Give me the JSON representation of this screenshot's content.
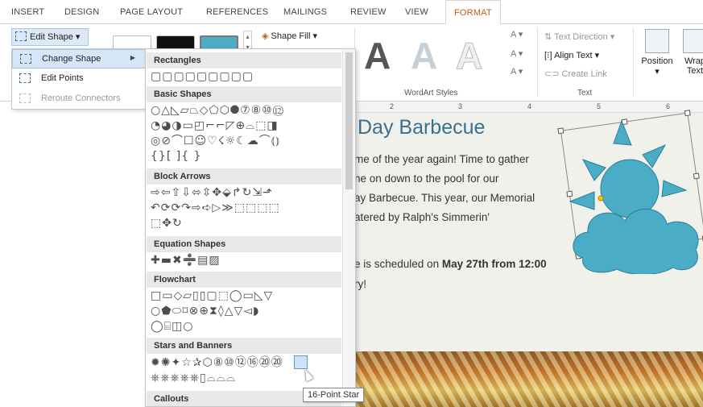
{
  "tabs": {
    "insert": "INSERT",
    "design": "DESIGN",
    "page_layout": "PAGE LAYOUT",
    "references": "REFERENCES",
    "mailings": "MAILINGS",
    "review": "REVIEW",
    "view": "VIEW",
    "format": "FORMAT",
    "active": "FORMAT"
  },
  "ribbon": {
    "edit_shape": "Edit Shape",
    "shape_fill": "Shape Fill",
    "wordart_letter": "A",
    "wordart_styles_label": "WordArt Styles",
    "text_direction": "Text Direction",
    "align_text": "Align Text",
    "create_link": "Create Link",
    "text_group_label": "Text",
    "position_label": "Position",
    "wrap_text_label": "Wrap Text"
  },
  "edit_menu": {
    "items": [
      {
        "label": "Change Shape",
        "has_submenu": true
      },
      {
        "label": "Edit Points",
        "has_submenu": false
      },
      {
        "label": "Reroute Connectors",
        "has_submenu": false,
        "disabled": true
      }
    ]
  },
  "gallery": {
    "sections": [
      {
        "title": "Rectangles",
        "rows": [
          "▢▢▢▢▢▢▢▢▢"
        ]
      },
      {
        "title": "Basic Shapes",
        "rows": [
          "○△◺▱⏢◇⬠⬡⯃⑦⑧⑩⑫",
          "◔◕◑▭◰⌐⌐◸⊕⌓⬚◨",
          "◎⊘⌒☐☺♡☇☼☾☁⌒⦅⦆",
          "{}[ ]{ }"
        ]
      },
      {
        "title": "Block Arrows",
        "rows": [
          "⇨⇦⇧⇩⬄⇳✥⬙↱↻⇲⬏",
          "↶⟳⟳↷⇨➪▷≫⬚⬚⬚⬚",
          "⬚✥↻"
        ]
      },
      {
        "title": "Equation Shapes",
        "rows": [
          "✚▬✖➗▤▨"
        ]
      },
      {
        "title": "Flowchart",
        "rows": [
          "□▭◇▱▯▯▢⬚◯▭◺▽",
          "○⬟⬭⌑⊗⊕⧗◊△▽◅◗",
          "◯⌸◫○"
        ]
      },
      {
        "title": "Stars and Banners",
        "rows": [
          "✹✺✦☆✰⬡⑧⑩⑫⑯⑳⑳",
          "⎈⎈⎈⎈⎈▯⌓⌓⌓"
        ]
      },
      {
        "title": "Callouts",
        "rows": []
      }
    ]
  },
  "tooltip": "16-Point Star",
  "document": {
    "title": "Day Barbecue",
    "lines": [
      "me of the year again! Time to gather",
      "ne on down to the pool for our",
      "ay Barbecue. This year, our Memorial",
      "atered by Ralph's Simmerin'"
    ],
    "schedule_prefix": "e is scheduled on ",
    "schedule_bold": "May 27th from 12:00",
    "last_line": "ry!"
  },
  "ruler": {
    "marks": [
      "2",
      "3",
      "4",
      "5",
      "6"
    ]
  },
  "colors": {
    "accent": "#c55a11",
    "shape_fill": "#4bacc6",
    "hover": "#d5e6f7"
  }
}
